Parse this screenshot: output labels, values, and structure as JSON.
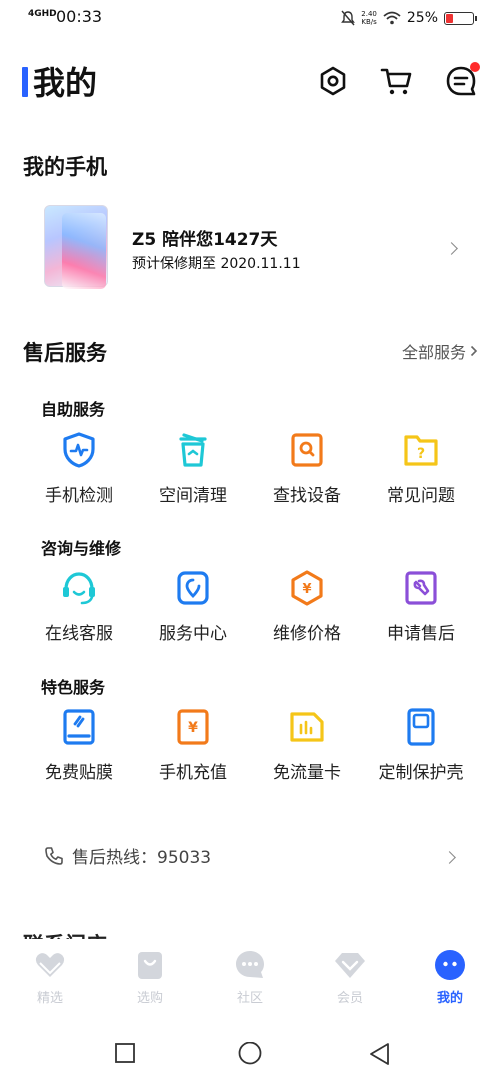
{
  "status_bar": {
    "network": "4GHD",
    "time": "00:33",
    "speed_value": "2.40",
    "speed_unit": "KB/s",
    "battery": "25%",
    "battery_level": 0.25
  },
  "header": {
    "title": "我的"
  },
  "my_phone": {
    "section_title": "我的手机",
    "name": "Z5 陪伴您1427天",
    "warranty": "预计保修期至 2020.11.11"
  },
  "after_sales": {
    "section_title": "售后服务",
    "all_services": "全部服务",
    "groups": [
      {
        "title": "自助服务",
        "items": [
          {
            "label": "手机检测",
            "icon": "shield-pulse-icon"
          },
          {
            "label": "空间清理",
            "icon": "trash-bin-icon"
          },
          {
            "label": "查找设备",
            "icon": "find-device-icon"
          },
          {
            "label": "常见问题",
            "icon": "question-folder-icon"
          }
        ]
      },
      {
        "title": "咨询与维修",
        "items": [
          {
            "label": "在线客服",
            "icon": "headset-icon"
          },
          {
            "label": "服务中心",
            "icon": "location-pin-icon"
          },
          {
            "label": "维修价格",
            "icon": "yen-badge-icon"
          },
          {
            "label": "申请售后",
            "icon": "wrench-icon"
          }
        ]
      },
      {
        "title": "特色服务",
        "items": [
          {
            "label": "免费贴膜",
            "icon": "screen-film-icon"
          },
          {
            "label": "手机充值",
            "icon": "yen-card-icon"
          },
          {
            "label": "免流量卡",
            "icon": "sim-card-icon"
          },
          {
            "label": "定制保护壳",
            "icon": "phone-case-icon"
          }
        ]
      }
    ],
    "hotline": "售后热线：95033"
  },
  "next_section_partial": "联系门店",
  "bottom_nav": [
    {
      "label": "精选",
      "icon": "heart-icon"
    },
    {
      "label": "选购",
      "icon": "shopping-bag-icon"
    },
    {
      "label": "社区",
      "icon": "chat-bubble-icon"
    },
    {
      "label": "会员",
      "icon": "vip-diamond-icon"
    },
    {
      "label": "我的",
      "icon": "profile-dots-icon"
    }
  ],
  "colors": {
    "accent": "#2962ff",
    "blue": "#1e7bf0",
    "cyan": "#1ec8d6",
    "orange": "#f27a1a",
    "yellow": "#f5c518",
    "purple": "#8b4fd8",
    "nav_inactive": "#d3d6dc",
    "notification": "#ff2a2a"
  }
}
